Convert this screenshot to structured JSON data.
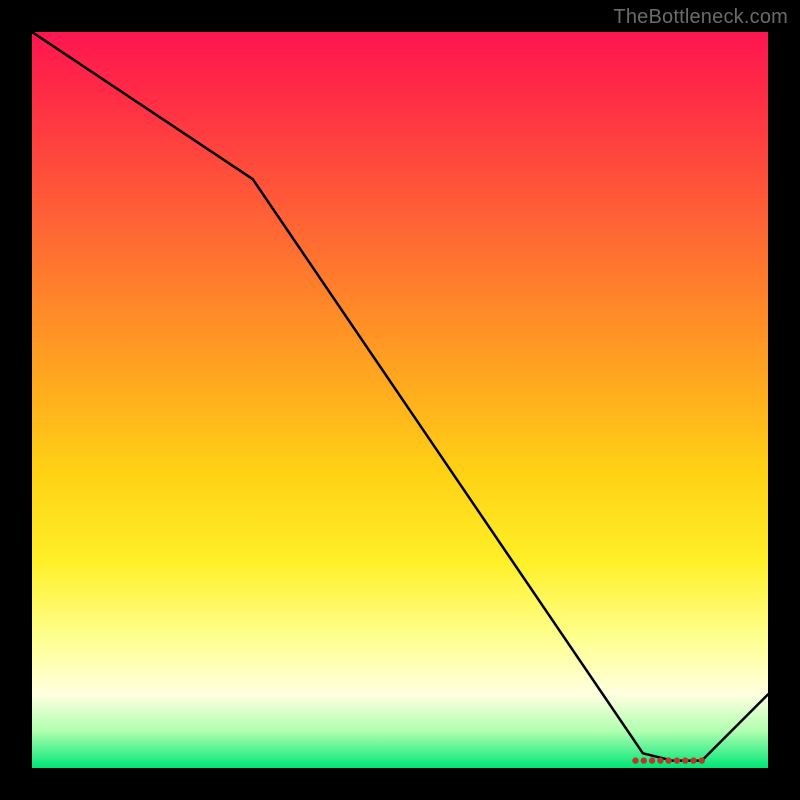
{
  "watermark": "TheBottleneck.com",
  "chart_data": {
    "type": "line",
    "title": "",
    "xlabel": "",
    "ylabel": "",
    "xlim": [
      0,
      100
    ],
    "ylim": [
      0,
      100
    ],
    "x": [
      0,
      30,
      83,
      87,
      91,
      100
    ],
    "values": [
      100,
      80,
      2,
      1,
      1,
      10
    ],
    "marker_region": {
      "x_start": 82,
      "x_end": 91,
      "y": 1
    },
    "colors": {
      "top": "#ff1650",
      "mid": "#ffd214",
      "bottom": "#00e676",
      "line": "#000000",
      "marker": "#b43a2a"
    }
  }
}
